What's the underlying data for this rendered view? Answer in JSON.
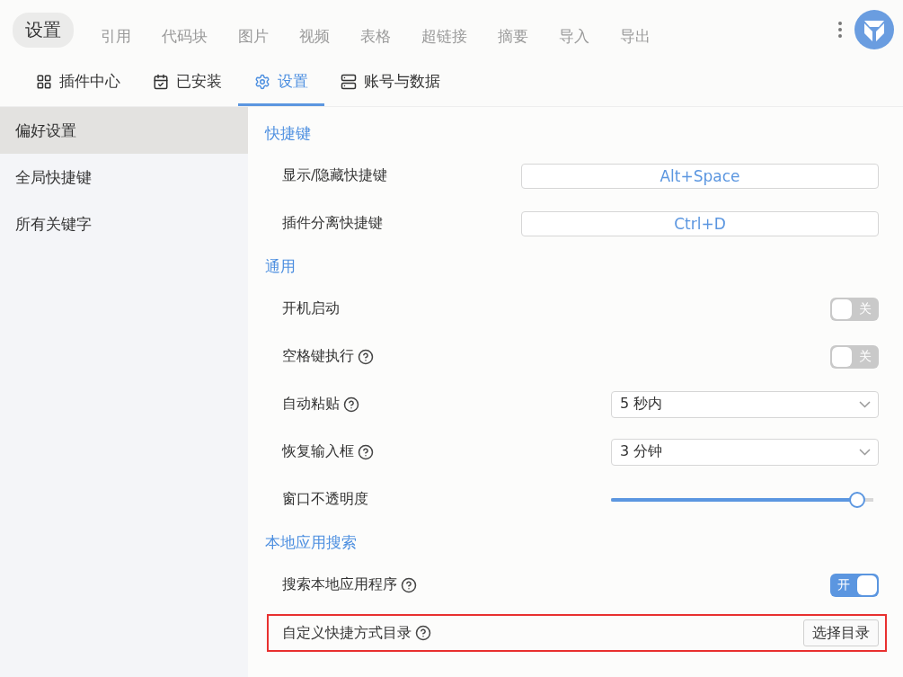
{
  "header": {
    "title": "设置"
  },
  "toolbar": [
    "引用",
    "代码块",
    "图片",
    "视频",
    "表格",
    "超链接",
    "摘要",
    "导入",
    "导出"
  ],
  "tabs": [
    {
      "label": "插件中心",
      "selected": false
    },
    {
      "label": "已安装",
      "selected": false
    },
    {
      "label": "设置",
      "selected": true
    },
    {
      "label": "账号与数据",
      "selected": false
    }
  ],
  "sidebar": {
    "items": [
      {
        "label": "偏好设置",
        "selected": true
      },
      {
        "label": "全局快捷键",
        "selected": false
      },
      {
        "label": "所有关键字",
        "selected": false
      }
    ]
  },
  "sections": [
    {
      "title": "快捷键",
      "items": [
        {
          "kind": "shortcut",
          "label": "显示/隐藏快捷键",
          "help": false,
          "value": "Alt+Space"
        },
        {
          "kind": "shortcut",
          "label": "插件分离快捷键",
          "help": false,
          "value": "Ctrl+D"
        }
      ]
    },
    {
      "title": "通用",
      "items": [
        {
          "kind": "toggle",
          "label": "开机启动",
          "help": false,
          "on": false,
          "text": "关"
        },
        {
          "kind": "toggle",
          "label": "空格键执行",
          "help": true,
          "on": false,
          "text": "关"
        },
        {
          "kind": "select",
          "label": "自动粘贴",
          "help": true,
          "value": "5 秒内"
        },
        {
          "kind": "select",
          "label": "恢复输入框",
          "help": true,
          "value": "3 分钟"
        },
        {
          "kind": "slider",
          "label": "窗口不透明度",
          "help": false,
          "level": 0.94
        }
      ]
    },
    {
      "title": "本地应用搜索",
      "items": [
        {
          "kind": "toggle",
          "label": "搜索本地应用程序",
          "help": true,
          "on": true,
          "text": "开"
        },
        {
          "kind": "button",
          "label": "自定义快捷方式目录",
          "help": true,
          "value": "选择目录",
          "highlighted": true
        }
      ]
    }
  ]
}
